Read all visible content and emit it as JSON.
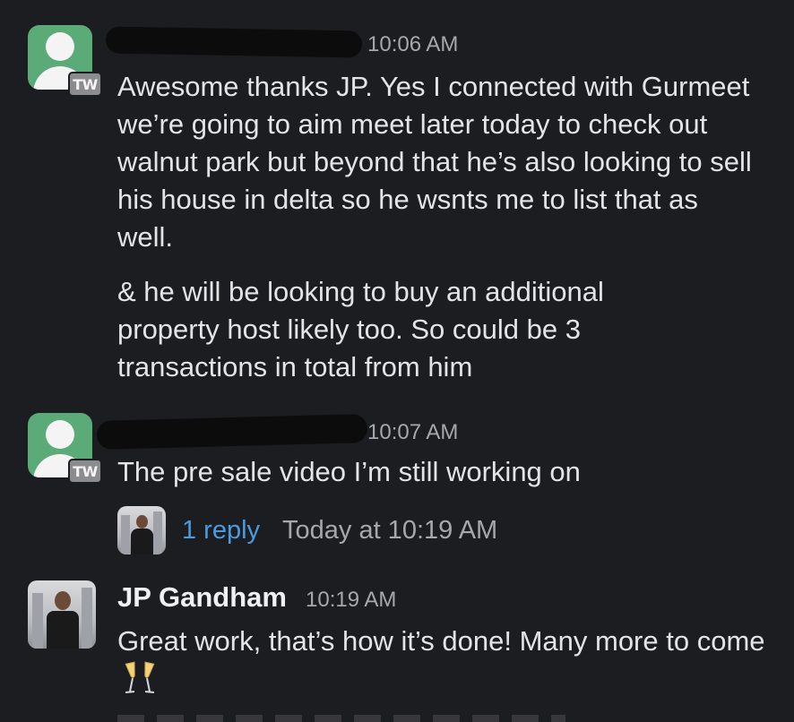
{
  "messages": [
    {
      "badge": "TW",
      "time": "10:06 AM",
      "paragraphs": [
        "Awesome thanks JP. Yes I connected with Gurmeet we’re going to aim meet later today to check out walnut park but beyond that he’s also looking to sell his house in delta so he wsnts me to list that as well.",
        "& he will be looking to buy an additional property host likely too. So could be 3 transactions in total from him"
      ]
    },
    {
      "badge": "TW",
      "time": "10:07 AM",
      "text": "The pre sale video I’m still working on",
      "thread": {
        "reply_count": "1 reply",
        "last_reply": "Today at 10:19 AM"
      }
    },
    {
      "author": "JP Gandham",
      "time": "10:19 AM",
      "text": "Great work, that’s how it’s done! Many more to come"
    }
  ],
  "colors": {
    "background": "#1c1d21",
    "link": "#4a9be0",
    "avatar_green": "#5bab79"
  },
  "icons": [
    "default-avatar-icon",
    "champagne-icon"
  ]
}
